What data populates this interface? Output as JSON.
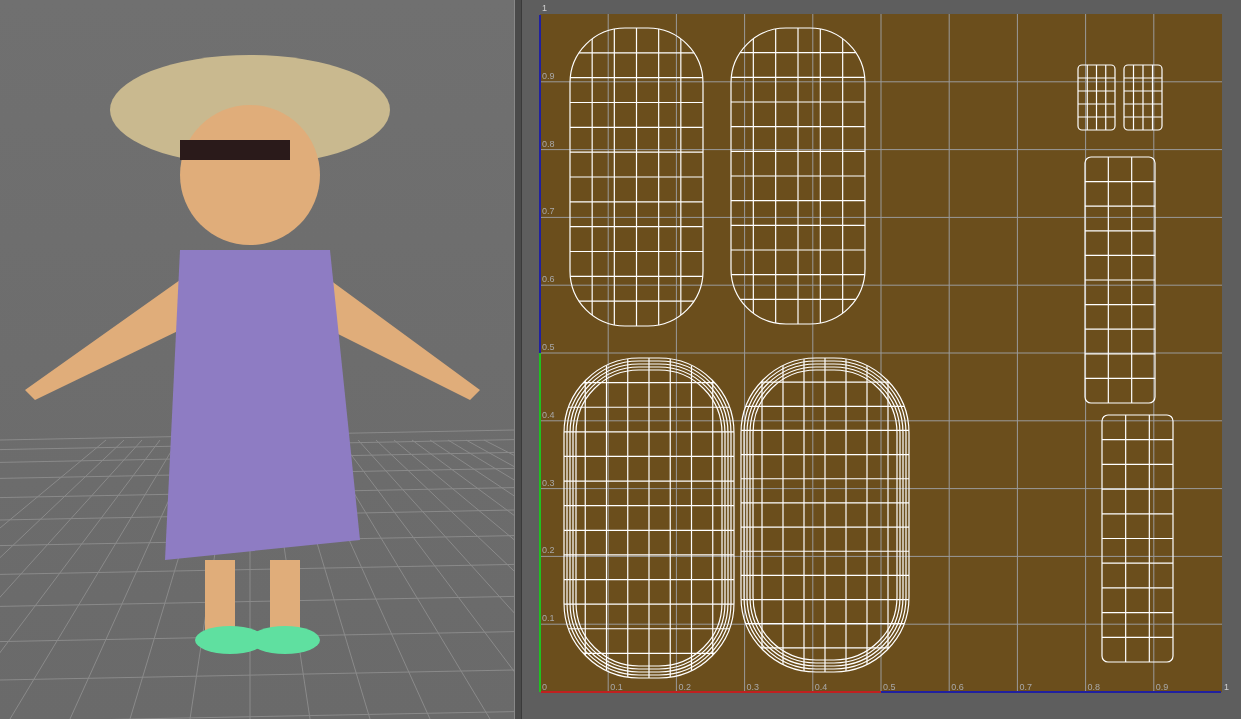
{
  "uv_editor": {
    "v_ticks": [
      "1",
      "0.9",
      "0.8",
      "0.7",
      "0.6",
      "0.5",
      "0.4",
      "0.3",
      "0.2",
      "0.1"
    ],
    "u_ticks": [
      "0",
      "0.1",
      "0.2",
      "0.3",
      "0.4",
      "0.5",
      "0.6",
      "0.7",
      "0.8",
      "0.9",
      "1"
    ]
  }
}
